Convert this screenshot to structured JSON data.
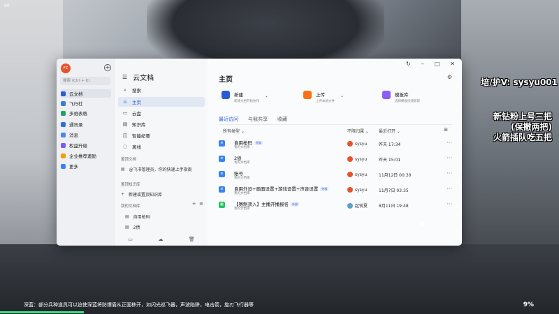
{
  "game": {
    "corner_label": "00",
    "overlay_contact": "培/护V: sysyu001",
    "overlay_promo": [
      "新钻粉上号三把",
      "(保撤两把)",
      "火箭插队吃五把"
    ],
    "bottom_tip": "深蓝：部分兵种道具可以迫使深蓝将防爆盾从正面移开，如闪光巡飞器，声波陷阱，电击箭，旋刃飞行器等",
    "percent": "9%"
  },
  "rail": {
    "avatar": "FZ",
    "search_placeholder": "搜索 (Ctrl + K)",
    "items": [
      {
        "label": "云文档",
        "color": "#2a5bd7",
        "icon": "cloud-doc-icon"
      },
      {
        "label": "飞行社",
        "color": "#3a7bd5",
        "icon": "flight-icon"
      },
      {
        "label": "多维表格",
        "color": "#22a06b",
        "icon": "table-icon"
      },
      {
        "label": "通讯录",
        "color": "#2f6fe4",
        "icon": "contacts-icon"
      },
      {
        "label": "消息",
        "color": "#4b87f0",
        "icon": "message-icon"
      },
      {
        "label": "权益升级",
        "color": "#7a5af8",
        "icon": "upgrade-icon"
      },
      {
        "label": "企业推荐邀励",
        "color": "#f59e0b",
        "icon": "referral-icon"
      },
      {
        "label": "更多",
        "color": "#3b82f6",
        "icon": "more-grid-icon"
      }
    ]
  },
  "sidebar": {
    "title": "云文档",
    "search_label": "搜索",
    "nav": [
      {
        "label": "主页",
        "glyph": "⌂"
      },
      {
        "label": "云盘",
        "glyph": "▭"
      },
      {
        "label": "知识库",
        "glyph": "▤"
      },
      {
        "label": "智能纪要",
        "glyph": "◫"
      },
      {
        "label": "离线",
        "glyph": "◌"
      }
    ],
    "pinned_section": "置顶文档",
    "pinned_doc": "@飞书管理员，你的快速上手指南",
    "wiki_section": "置顶知识库",
    "wiki_new": "新建或置顶知识库",
    "mylib_section": "我的文档库",
    "mylib_items": [
      "自用枪码",
      "2债"
    ]
  },
  "main": {
    "title": "主页",
    "cards": [
      {
        "title": "新建",
        "sub": "新建文档开始协作",
        "color": "#2a5bd7"
      },
      {
        "title": "上传",
        "sub": "上传本地文件",
        "color": "#f97316"
      },
      {
        "title": "模板库",
        "sub": "选择模板快速新建",
        "color": "#8b5cf6"
      }
    ],
    "tabs": [
      "最近访问",
      "与我共享",
      "收藏"
    ],
    "columns": {
      "type": "所有类型",
      "owner": "不限归属",
      "time": "最近打开"
    },
    "rows": [
      {
        "name": "自用枪码",
        "tag": "外部",
        "sub": "我的文档库",
        "owner": "sysyu",
        "time": "昨天 17:34",
        "color": "#3b82f6"
      },
      {
        "name": "2债",
        "tag": "",
        "sub": "我的文档库",
        "owner": "sysyu",
        "time": "昨天 15:01",
        "color": "#3b82f6"
      },
      {
        "name": "账号",
        "tag": "",
        "sub": "我的文档库",
        "owner": "sysyu",
        "time": "11月12日 00:30",
        "color": "#3b82f6"
      },
      {
        "name": "自用外设+画面设置+游戏设置+声音设置",
        "tag": "外部",
        "sub": "我的文档库",
        "owner": "sysyu",
        "time": "11月7日 03:35",
        "color": "#3b82f6"
      },
      {
        "name": "【赛制须入】主播开播报名",
        "tag": "外部",
        "sub": "我的文档库",
        "owner": "起锐夏",
        "time": "8月11日 19:48",
        "color": "#22c55e"
      }
    ]
  }
}
